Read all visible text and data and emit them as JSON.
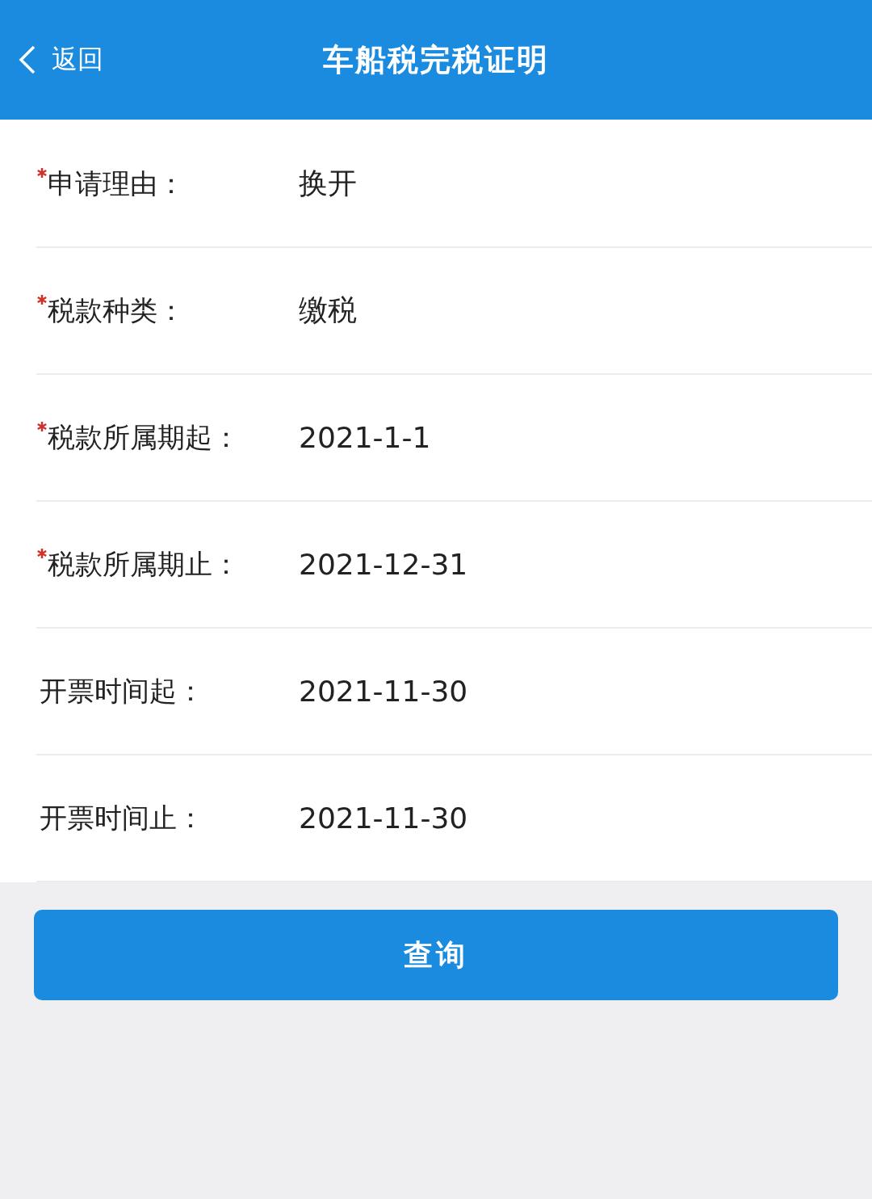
{
  "header": {
    "back": "返回",
    "title": "车船税完税证明"
  },
  "rows": [
    {
      "label": "申请理由：",
      "value": "换开",
      "required": true
    },
    {
      "label": "税款种类：",
      "value": "缴税",
      "required": true
    },
    {
      "label": "税款所属期起：",
      "value": "2021-1-1",
      "required": true
    },
    {
      "label": "税款所属期止：",
      "value": "2021-12-31",
      "required": true
    },
    {
      "label": "开票时间起：",
      "value": "2021-11-30",
      "required": false
    },
    {
      "label": "开票时间止：",
      "value": "2021-11-30",
      "required": false
    }
  ],
  "button": "查询"
}
